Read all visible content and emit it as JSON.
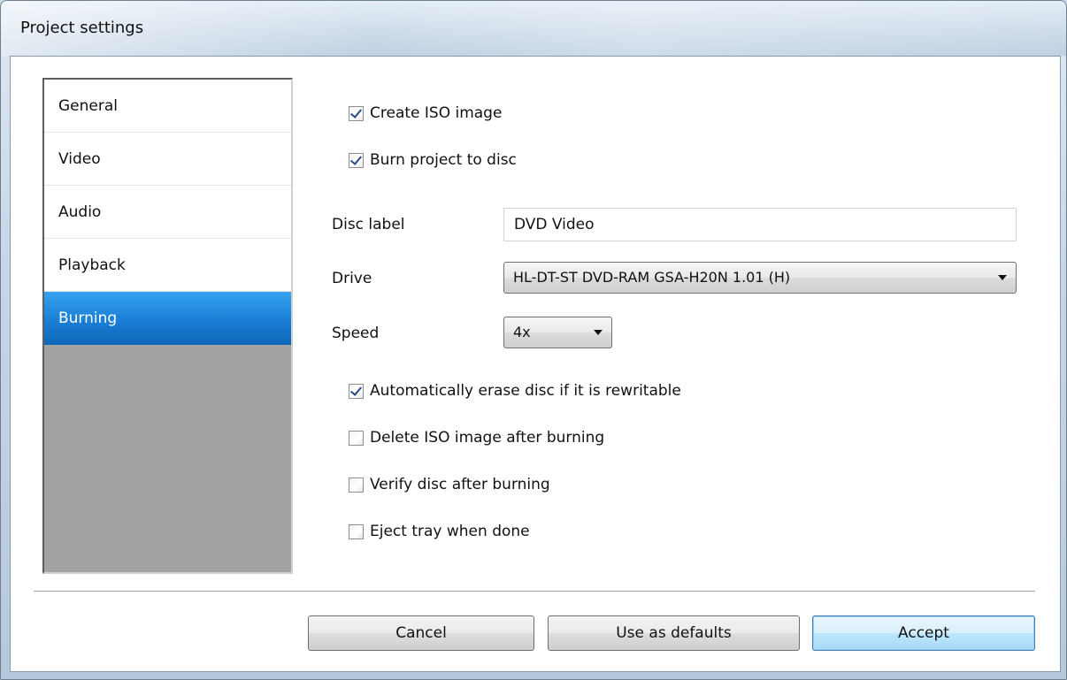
{
  "window": {
    "title": "Project settings"
  },
  "sidebar": {
    "items": [
      {
        "label": "General"
      },
      {
        "label": "Video"
      },
      {
        "label": "Audio"
      },
      {
        "label": "Playback"
      },
      {
        "label": "Burning",
        "selected": true
      }
    ]
  },
  "burning": {
    "create_iso": {
      "label": "Create ISO image",
      "checked": true
    },
    "burn_to_disc": {
      "label": "Burn project to disc",
      "checked": true
    },
    "disc_label": {
      "label": "Disc label",
      "value": "DVD Video"
    },
    "drive": {
      "label": "Drive",
      "value": "HL-DT-ST DVD-RAM GSA-H20N 1.01 (H)"
    },
    "speed": {
      "label": "Speed",
      "value": "4x"
    },
    "auto_erase": {
      "label": "Automatically erase disc if it is rewritable",
      "checked": true
    },
    "delete_iso": {
      "label": "Delete ISO image after burning",
      "checked": false
    },
    "verify": {
      "label": "Verify disc after burning",
      "checked": false
    },
    "eject": {
      "label": "Eject tray when done",
      "checked": false
    }
  },
  "buttons": {
    "cancel": "Cancel",
    "defaults": "Use as defaults",
    "accept": "Accept"
  },
  "colors": {
    "selection_blue": "#1a7fd6",
    "sidebar_empty": "#a3a3a3"
  }
}
